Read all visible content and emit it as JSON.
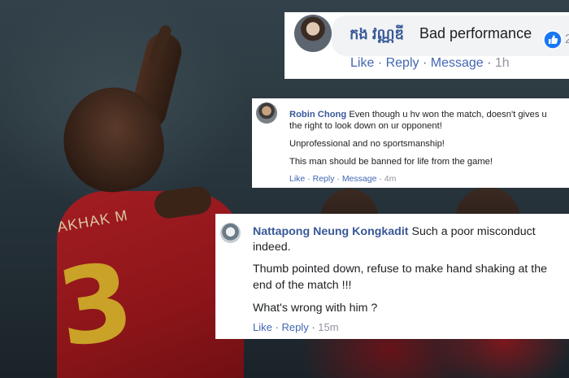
{
  "background": {
    "jersey_name": "AKHAK M",
    "jersey_number": "3"
  },
  "comments": [
    {
      "author": "កង វណ្ណឌី",
      "text": "Bad performance",
      "reaction_count": "2",
      "actions": {
        "like": "Like",
        "reply": "Reply",
        "message": "Message",
        "separator": "·",
        "time": "1h"
      }
    },
    {
      "author": "Robin Chong",
      "lines": [
        "Even though u hv won the match, doesn't gives u",
        "the right to look down on ur opponent!",
        "Unprofessional and no sportsmanship!",
        "This man should be banned for life from the game!"
      ],
      "actions": {
        "like": "Like",
        "reply": "Reply",
        "message": "Message",
        "separator": "·",
        "time": "4m"
      }
    },
    {
      "author": "Nattapong Neung Kongkadit",
      "lines": [
        "Such a poor misconduct",
        "indeed.",
        "Thumb pointed down, refuse to make hand shaking at the",
        "end of the match !!!",
        "What's wrong with him ?"
      ],
      "actions": {
        "like": "Like",
        "reply": "Reply",
        "separator": "·",
        "time": "15m"
      }
    }
  ],
  "colors": {
    "name": "#385898",
    "action": "#4267b2",
    "like_badge": "#1877f2"
  }
}
